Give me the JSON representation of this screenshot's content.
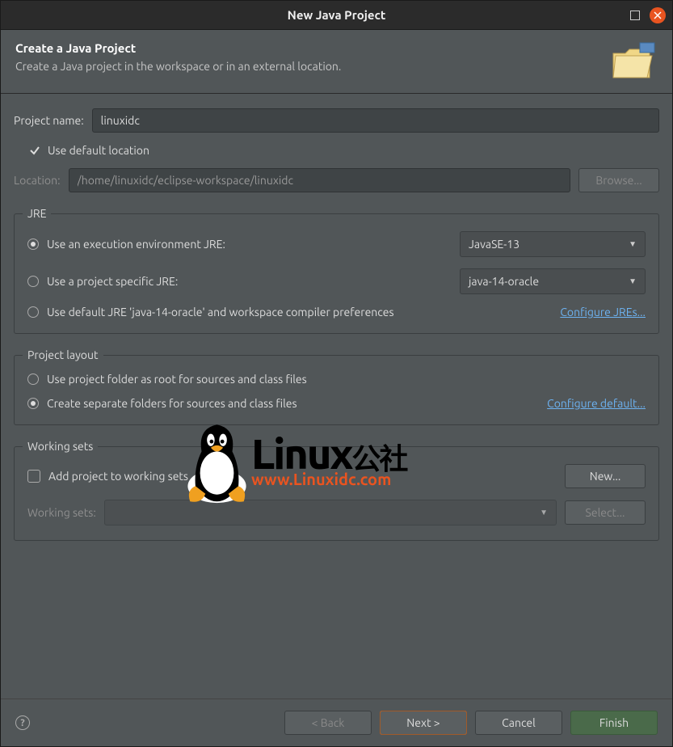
{
  "titlebar": {
    "title": "New Java Project"
  },
  "header": {
    "title": "Create a Java Project",
    "subtitle": "Create a Java project in the workspace or in an external location."
  },
  "project": {
    "name_label": "Project name:",
    "name_value": "linuxidc",
    "use_default_label": "Use default location",
    "use_default_checked": true,
    "location_label": "Location:",
    "location_value": "/home/linuxidc/eclipse-workspace/linuxidc",
    "browse_label": "Browse..."
  },
  "jre": {
    "legend": "JRE",
    "opt_exec_env": "Use an execution environment JRE:",
    "exec_env_value": "JavaSE-13",
    "opt_project_jre": "Use a project specific JRE:",
    "project_jre_value": "java-14-oracle",
    "opt_default_jre": "Use default JRE 'java-14-oracle' and workspace compiler preferences",
    "configure_link": "Configure JREs..."
  },
  "layout": {
    "legend": "Project layout",
    "opt_root": "Use project folder as root for sources and class files",
    "opt_separate": "Create separate folders for sources and class files",
    "configure_link": "Configure default..."
  },
  "working_sets": {
    "legend": "Working sets",
    "add_label": "Add project to working sets",
    "new_label": "New...",
    "ws_label": "Working sets:",
    "select_label": "Select..."
  },
  "footer": {
    "back": "< Back",
    "next": "Next >",
    "cancel": "Cancel",
    "finish": "Finish"
  },
  "watermark": {
    "text_main": "Linux",
    "text_cn": "公社",
    "url": "www.Linuxidc.com"
  }
}
